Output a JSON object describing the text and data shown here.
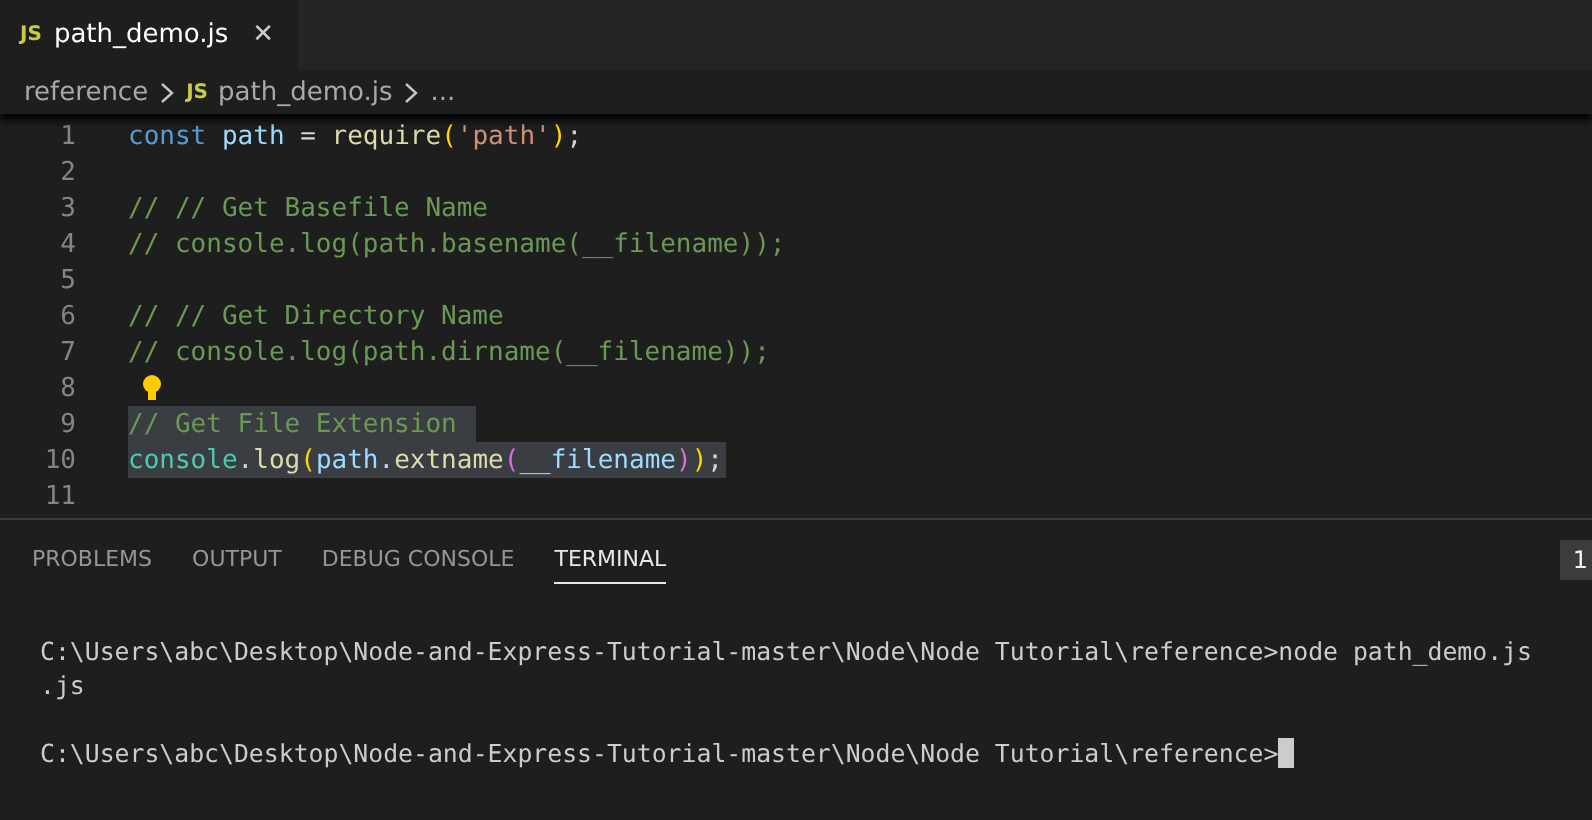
{
  "editor_tab": {
    "icon_text": "JS",
    "title": "path_demo.js",
    "close": "✕"
  },
  "breadcrumbs": [
    {
      "text": "reference",
      "kind": "folder"
    },
    {
      "text": "path_demo.js",
      "kind": "file",
      "icon_text": "JS"
    },
    {
      "text": "...",
      "kind": "more"
    }
  ],
  "code_lines": [
    {
      "number": "1",
      "highlighted": false,
      "lightbulb": false,
      "tokens": [
        {
          "text": "const ",
          "kind": "keyword"
        },
        {
          "text": "path",
          "kind": "var"
        },
        {
          "text": " = ",
          "kind": "plain"
        },
        {
          "text": "require",
          "kind": "func"
        },
        {
          "text": "(",
          "kind": "paren"
        },
        {
          "text": "'path'",
          "kind": "string"
        },
        {
          "text": ")",
          "kind": "paren"
        },
        {
          "text": ";",
          "kind": "plain"
        }
      ]
    },
    {
      "number": "2",
      "highlighted": false,
      "lightbulb": false
    },
    {
      "number": "3",
      "highlighted": false,
      "lightbulb": false,
      "tokens": [
        {
          "text": "// // Get Basefile Name",
          "kind": "comment"
        }
      ]
    },
    {
      "number": "4",
      "highlighted": false,
      "lightbulb": false,
      "tokens": [
        {
          "text": "// console.log(path.basename(__filename));",
          "kind": "comment"
        }
      ]
    },
    {
      "number": "5",
      "highlighted": false,
      "lightbulb": false
    },
    {
      "number": "6",
      "highlighted": false,
      "lightbulb": false,
      "tokens": [
        {
          "text": "// // Get Directory Name",
          "kind": "comment"
        }
      ]
    },
    {
      "number": "7",
      "highlighted": false,
      "lightbulb": false,
      "tokens": [
        {
          "text": "// console.log(path.dirname(__filename));",
          "kind": "comment"
        }
      ]
    },
    {
      "number": "8",
      "highlighted": false,
      "lightbulb": true
    },
    {
      "number": "9",
      "highlighted": true,
      "lightbulb": false,
      "tokens": [
        {
          "text": "// Get File Extension ",
          "kind": "comment"
        }
      ]
    },
    {
      "number": "10",
      "highlighted": true,
      "lightbulb": false,
      "tokens": [
        {
          "text": "console",
          "kind": "class"
        },
        {
          "text": ".",
          "kind": "plain"
        },
        {
          "text": "log",
          "kind": "func"
        },
        {
          "text": "(",
          "kind": "paren"
        },
        {
          "text": "path",
          "kind": "var"
        },
        {
          "text": ".",
          "kind": "plain"
        },
        {
          "text": "extname",
          "kind": "func"
        },
        {
          "text": "(",
          "kind": "paren2"
        },
        {
          "text": "__filename",
          "kind": "var"
        },
        {
          "text": ")",
          "kind": "paren2"
        },
        {
          "text": ")",
          "kind": "paren"
        },
        {
          "text": ";",
          "kind": "plain"
        }
      ]
    },
    {
      "number": "11",
      "highlighted": false,
      "lightbulb": false
    }
  ],
  "panel_tabs": [
    {
      "label": "PROBLEMS",
      "selected": false
    },
    {
      "label": "OUTPUT",
      "selected": false
    },
    {
      "label": "DEBUG CONSOLE",
      "selected": false
    },
    {
      "label": "TERMINAL",
      "selected": true
    }
  ],
  "terminal_instance": "1",
  "terminal_lines": [
    {
      "text": "C:\\Users\\abc\\Desktop\\Node-and-Express-Tutorial-master\\Node\\Node Tutorial\\reference>node path_demo.js",
      "cursor": false
    },
    {
      "text": ".js",
      "cursor": false
    },
    {
      "cursor": false
    },
    {
      "text": "C:\\Users\\abc\\Desktop\\Node-and-Express-Tutorial-master\\Node\\Node Tutorial\\reference>",
      "cursor": true
    }
  ]
}
